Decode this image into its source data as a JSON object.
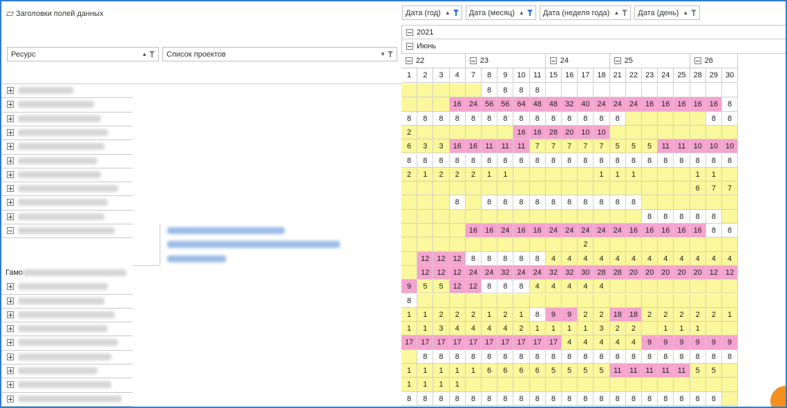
{
  "header": {
    "data_fields_label": "Заголовки полей данных",
    "row_fields": [
      {
        "label": "Ресурс",
        "filtered": false
      },
      {
        "label": "Список проектов",
        "filtered": false
      }
    ],
    "col_fields": [
      {
        "label": "Дата (год)",
        "filtered": true
      },
      {
        "label": "Дата (месяц)",
        "filtered": true
      },
      {
        "label": "Дата (неделя года)",
        "filtered": false
      },
      {
        "label": "Дата (день)",
        "filtered": false
      }
    ],
    "year": "2021",
    "month": "Июнь",
    "weeks": [
      {
        "label": "22",
        "span": 4
      },
      {
        "label": "23",
        "span": 5
      },
      {
        "label": "24",
        "span": 4
      },
      {
        "label": "25",
        "span": 5
      },
      {
        "label": "26",
        "span": 3
      }
    ],
    "days": [
      "1",
      "2",
      "3",
      "4",
      "7",
      "8",
      "9",
      "10",
      "11",
      "15",
      "16",
      "17",
      "18",
      "21",
      "22",
      "23",
      "24",
      "25",
      "28",
      "29",
      "30"
    ]
  },
  "special_row_label": "Гамо",
  "colors": {
    "yellow": "#fbf79c",
    "pink": "#f5a3cf",
    "frame": "#2f7bd6",
    "accent": "#f39020"
  },
  "rows": [
    {
      "expand": "plus",
      "nw": 80,
      "cells": [
        "y",
        "y",
        "y",
        "y",
        "y",
        "w:8",
        "w:8",
        "w:8",
        "w:8",
        "w",
        "w",
        "w",
        "w",
        "w",
        "w",
        "w",
        "w",
        "w",
        "w",
        "w",
        "w"
      ]
    },
    {
      "expand": "plus",
      "nw": 110,
      "cells": [
        "y",
        "y",
        "y",
        "p:16",
        "p:24",
        "p:56",
        "p:56",
        "p:64",
        "p:48",
        "p:48",
        "p:32",
        "p:40",
        "p:24",
        "p:24",
        "p:24",
        "p:16",
        "p:16",
        "p:16",
        "p:16",
        "p:16",
        "w:8"
      ]
    },
    {
      "expand": "plus",
      "nw": 120,
      "cells": [
        "w:8",
        "w:8",
        "w:8",
        "w:8",
        "w:8",
        "w:8",
        "w:8",
        "w:8",
        "w:8",
        "w:8",
        "w:8",
        "w:8",
        "w:8",
        "w:8",
        "y",
        "y",
        "y",
        "y",
        "y",
        "w:8",
        "w:8"
      ]
    },
    {
      "expand": "plus",
      "nw": 130,
      "cells": [
        "y:2",
        "y",
        "y",
        "y",
        "y",
        "y",
        "y",
        "p:16",
        "p:16",
        "p:28",
        "p:20",
        "p:10",
        "p:10",
        "y",
        "y",
        "y",
        "y",
        "y",
        "y",
        "y",
        "y"
      ]
    },
    {
      "expand": "plus",
      "nw": 125,
      "cells": [
        "y:6",
        "y:3",
        "y:3",
        "p:16",
        "p:16",
        "p:11",
        "p:11",
        "p:11",
        "y:7",
        "y:7",
        "y:7",
        "y:7",
        "y:7",
        "y:5",
        "y:5",
        "y:5",
        "p:11",
        "p:11",
        "p:10",
        "p:10",
        "p:10"
      ]
    },
    {
      "expand": "plus",
      "nw": 115,
      "cells": [
        "w:8",
        "w:8",
        "w:8",
        "w:8",
        "w:8",
        "w:8",
        "w:8",
        "w:8",
        "w:8",
        "w:8",
        "w:8",
        "w:8",
        "w:8",
        "w:8",
        "w:8",
        "w:8",
        "w:8",
        "w:8",
        "w:8",
        "w:8",
        "w:8"
      ]
    },
    {
      "expand": "plus",
      "nw": 120,
      "cells": [
        "y:2",
        "y:1",
        "y:2",
        "y:2",
        "y:2",
        "y:1",
        "y:1",
        "y",
        "y",
        "y",
        "y",
        "y",
        "y:1",
        "y:1",
        "y:1",
        "y",
        "y",
        "y",
        "y:1",
        "y:1",
        "y"
      ]
    },
    {
      "expand": "plus",
      "nw": 145,
      "cells": [
        "y",
        "y",
        "y",
        "y",
        "y",
        "y",
        "y",
        "y",
        "y",
        "y",
        "y",
        "y",
        "y",
        "y",
        "y",
        "y",
        "y",
        "y",
        "y:6",
        "y:7",
        "y:7"
      ]
    },
    {
      "expand": "plus",
      "nw": 130,
      "cells": [
        "y",
        "y",
        "y",
        "w:8",
        "y",
        "w:8",
        "w:8",
        "w:8",
        "w:8",
        "w:8",
        "w:8",
        "w:8",
        "w:8",
        "w:8",
        "w:8",
        "y",
        "y",
        "y",
        "y",
        "y",
        "y"
      ]
    },
    {
      "expand": "plus",
      "nw": 125,
      "cells": [
        "y",
        "y",
        "y",
        "y",
        "y",
        "y",
        "y",
        "y",
        "y",
        "y",
        "y",
        "y",
        "y",
        "y",
        "y",
        "w:8",
        "w:8",
        "w:8",
        "w:8",
        "w:8",
        "y"
      ]
    },
    {
      "expand": "minus",
      "nw": 140,
      "cells": [
        "y",
        "y",
        "y",
        "y",
        "p:16",
        "p:16",
        "p:24",
        "p:16",
        "p:16",
        "p:24",
        "p:24",
        "p:24",
        "p:24",
        "p:24",
        "p:16",
        "p:16",
        "p:16",
        "p:16",
        "p:16",
        "w:8",
        "w:8"
      ]
    },
    {
      "expand": "none",
      "nw": 0,
      "cells": [
        "y",
        "y",
        "y",
        "y",
        "y",
        "y",
        "y",
        "y",
        "y",
        "y",
        "y",
        "y:2",
        "y",
        "y",
        "y",
        "y",
        "y",
        "y",
        "y",
        "y",
        "y"
      ]
    },
    {
      "expand": "none",
      "nw": 0,
      "cells": [
        "y",
        "p:12",
        "p:12",
        "p:12",
        "w:8",
        "w:8",
        "w:8",
        "w:8",
        "w:8",
        "y:4",
        "y:4",
        "y:4",
        "y:4",
        "y:4",
        "y:4",
        "y:4",
        "y:4",
        "y:4",
        "y:4",
        "y:4",
        "y:4"
      ]
    },
    {
      "expand": "total",
      "nw": 150,
      "cells": [
        "y",
        "p:12",
        "p:12",
        "p:12",
        "p:24",
        "p:24",
        "p:32",
        "p:24",
        "p:24",
        "p:32",
        "p:32",
        "p:30",
        "p:28",
        "p:28",
        "p:20",
        "p:20",
        "p:20",
        "p:20",
        "p:20",
        "p:12",
        "p:12"
      ]
    },
    {
      "expand": "plus",
      "nw": 130,
      "cells": [
        "p:9",
        "y:5",
        "y:5",
        "p:12",
        "p:12",
        "w:8",
        "w:8",
        "w:8",
        "y:4",
        "y:4",
        "y:4",
        "y:4",
        "y:4",
        "y",
        "y",
        "y",
        "y",
        "y",
        "y",
        "y",
        "y"
      ]
    },
    {
      "expand": "plus",
      "nw": 125,
      "cells": [
        "w:8",
        "y",
        "y",
        "y",
        "y",
        "y",
        "y",
        "y",
        "y",
        "y",
        "y",
        "y",
        "y",
        "y",
        "y",
        "y",
        "y",
        "y",
        "y",
        "y",
        "y"
      ]
    },
    {
      "expand": "plus",
      "nw": 140,
      "cells": [
        "y:1",
        "y:1",
        "y:2",
        "y:2",
        "y:2",
        "y:1",
        "y:2",
        "y:1",
        "w:8",
        "p:9",
        "p:9",
        "y:2",
        "y:2",
        "p:18",
        "p:18",
        "y:2",
        "y:2",
        "y:2",
        "y:2",
        "y:2",
        "y:1"
      ]
    },
    {
      "expand": "plus",
      "nw": 130,
      "cells": [
        "y:1",
        "y:1",
        "y:3",
        "y:4",
        "y:4",
        "y:4",
        "y:4",
        "y:2",
        "y:1",
        "y:1",
        "y:1",
        "y:1",
        "y:3",
        "y:2",
        "y:2",
        "y",
        "y:1",
        "y:1",
        "y:1",
        "y",
        "y"
      ]
    },
    {
      "expand": "plus",
      "nw": 145,
      "cells": [
        "p:17",
        "p:17",
        "p:17",
        "p:17",
        "p:17",
        "p:17",
        "p:17",
        "p:17",
        "p:17",
        "p:17",
        "y:4",
        "y:4",
        "y:4",
        "y:4",
        "y:4",
        "p:9",
        "p:9",
        "p:9",
        "p:9",
        "p:9",
        "p:9"
      ]
    },
    {
      "expand": "plus",
      "nw": 135,
      "cells": [
        "y",
        "w:8",
        "w:8",
        "w:8",
        "w:8",
        "w:8",
        "w:8",
        "w:8",
        "w:8",
        "w:8",
        "w:8",
        "w:8",
        "w:8",
        "w:8",
        "w:8",
        "w:8",
        "w:8",
        "w:8",
        "w:8",
        "w:8",
        "w:8"
      ]
    },
    {
      "expand": "plus",
      "nw": 115,
      "cells": [
        "y:1",
        "y:1",
        "y:1",
        "y:1",
        "y:1",
        "y:6",
        "y:6",
        "y:6",
        "y:6",
        "y:5",
        "y:5",
        "y:5",
        "y:5",
        "p:11",
        "p:11",
        "p:11",
        "p:11",
        "p:11",
        "y:5",
        "y:5",
        "y"
      ]
    },
    {
      "expand": "plus",
      "nw": 135,
      "cells": [
        "y:1",
        "y:1",
        "y:1",
        "y:1",
        "y",
        "y",
        "y",
        "y",
        "y",
        "y",
        "y",
        "y",
        "y",
        "y",
        "y",
        "y",
        "y",
        "y",
        "y",
        "y",
        "y"
      ]
    },
    {
      "expand": "plus",
      "nw": 150,
      "cells": [
        "w:8",
        "w:8",
        "w:8",
        "w:8",
        "w:8",
        "w:8",
        "w:8",
        "w:8",
        "w:8",
        "w:8",
        "w:8",
        "w:8",
        "w:8",
        "w:8",
        "w:8",
        "w:8",
        "w:8",
        "w:8",
        "w:8",
        "w:8",
        "y"
      ]
    }
  ]
}
